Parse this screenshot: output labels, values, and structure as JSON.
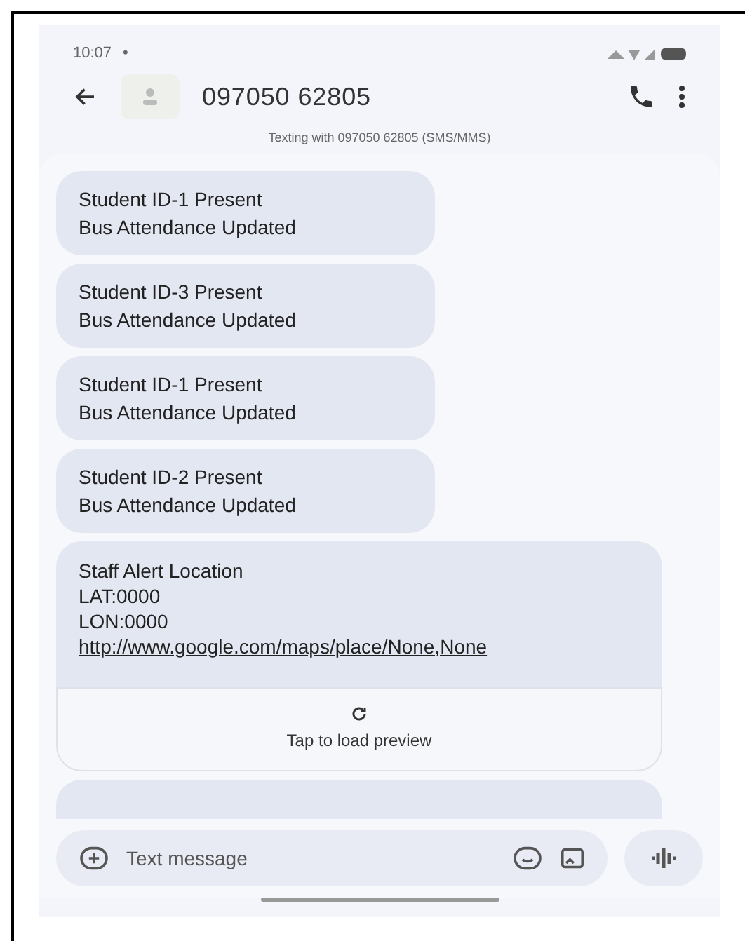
{
  "status_bar": {
    "time": "10:07",
    "indicator": "•"
  },
  "header": {
    "title": "097050 62805",
    "subtitle": "Texting with 097050 62805 (SMS/MMS)"
  },
  "messages": [
    {
      "kind": "text",
      "lines": [
        "Student ID-1 Present",
        "Bus Attendance Updated"
      ]
    },
    {
      "kind": "text",
      "lines": [
        "Student ID-3 Present",
        "Bus Attendance Updated"
      ]
    },
    {
      "kind": "text",
      "lines": [
        "Student ID-1 Present",
        "Bus Attendance Updated"
      ]
    },
    {
      "kind": "text",
      "lines": [
        "Student ID-2 Present",
        "Bus Attendance Updated"
      ]
    },
    {
      "kind": "link",
      "lines": [
        "Staff Alert Location",
        "LAT:0000",
        "LON:0000"
      ],
      "link": "http://www.google.com/maps/place/None,None",
      "preview": "Tap to load preview"
    }
  ],
  "composer": {
    "placeholder": "Text message"
  }
}
